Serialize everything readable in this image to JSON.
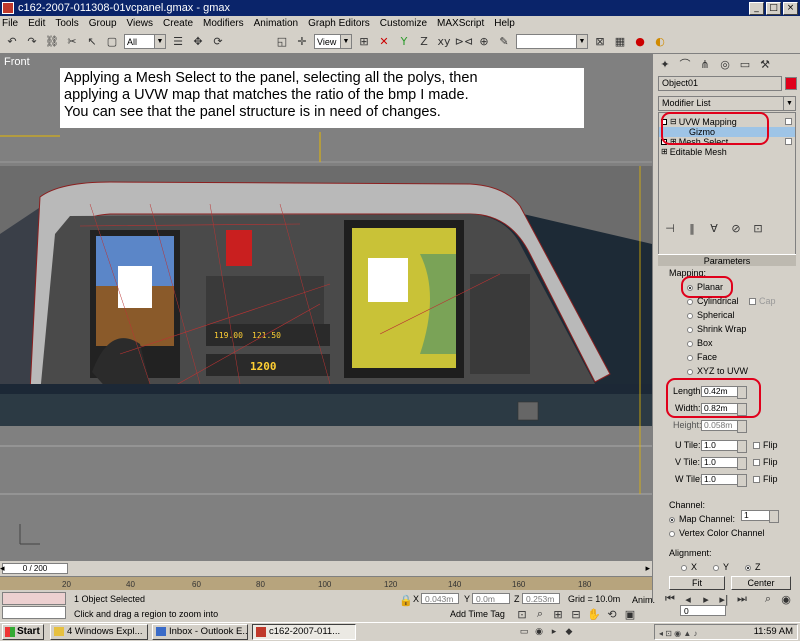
{
  "window": {
    "title": "c162-2007-011308-01vcpanel.gmax - gmax",
    "minimize_glyph": "_",
    "maximize_glyph": "□",
    "close_glyph": "×"
  },
  "menu": [
    "File",
    "Edit",
    "Tools",
    "Group",
    "Views",
    "Create",
    "Modifiers",
    "Animation",
    "Graph Editors",
    "Customize",
    "MAXScript",
    "Help"
  ],
  "toolbar": {
    "selection_filter": "All",
    "reference_coord": "View"
  },
  "viewport": {
    "label": "Front",
    "annotation_lines": [
      "Applying a Mesh Select to the panel, selecting all the polys, then",
      "applying a UVW map that matches the ratio of the bmp I made.",
      "You can see that the panel structure is in need of changes."
    ],
    "radio_freq": "119.00",
    "radio_freq2": "121.50",
    "transponder": "1200"
  },
  "command_panel": {
    "object_name": "Object01",
    "modifier_list_label": "Modifier List",
    "stack": [
      {
        "label": "UVW Mapping",
        "expanded": true
      },
      {
        "label": "Gizmo",
        "selected": true
      },
      {
        "label": "Mesh Select"
      },
      {
        "label": "Editable Mesh"
      }
    ],
    "params_title": "Parameters",
    "mapping_label": "Mapping:",
    "mapping_options": [
      "Planar",
      "Cylindrical",
      "Spherical",
      "Shrink Wrap",
      "Box",
      "Face",
      "XYZ to UVW"
    ],
    "mapping_selected": "Planar",
    "cap_label": "Cap",
    "length_label": "Length:",
    "length_value": "0.42m",
    "width_label": "Width:",
    "width_value": "0.82m",
    "height_label": "Height:",
    "height_value": "0.058m",
    "utile_label": "U Tile:",
    "utile_value": "1.0",
    "vtile_label": "V Tile:",
    "vtile_value": "1.0",
    "wtile_label": "W Tile:",
    "wtile_value": "1.0",
    "flip_label": "Flip",
    "channel_label": "Channel:",
    "map_channel_label": "Map Channel:",
    "map_channel_value": "1",
    "vertex_color_label": "Vertex Color Channel",
    "alignment_label": "Alignment:",
    "align_x": "X",
    "align_y": "Y",
    "align_z": "Z",
    "fit_label": "Fit",
    "center_label": "Center"
  },
  "timeline": {
    "frame_display": "0 / 200",
    "ticks": [
      "20",
      "40",
      "60",
      "80",
      "100",
      "120",
      "140",
      "160",
      "180"
    ]
  },
  "status": {
    "selection": "1 Object Selected",
    "prompt": "Click and drag a region to zoom into",
    "x_value": "0.043m",
    "y_value": "0.0m",
    "z_value": "0.253m",
    "grid": "Grid = 10.0m",
    "add_time_tag": "Add Time Tag",
    "anim_label": "Anim.",
    "frame_field": "0",
    "x_label": "X",
    "y_label": "Y",
    "z_label": "Z"
  },
  "taskbar": {
    "start": "Start",
    "tasks": [
      "4 Windows Expl...",
      "Inbox - Outlook E...",
      "c162-2007-011..."
    ],
    "clock": "11:59 AM"
  },
  "colors": {
    "titlebar": "#0a246a",
    "highlight_red": "#e0001b",
    "viewport_gray": "#808080",
    "ruler": "#b7a47d"
  }
}
